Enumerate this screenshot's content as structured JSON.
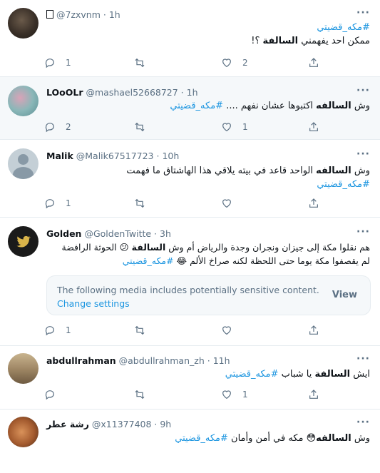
{
  "tweets": [
    {
      "display_name": "",
      "handle": "@7zxvnm",
      "time": "1h",
      "lines": [
        [
          {
            "t": "#مكه_قضيتي",
            "c": "hash"
          }
        ],
        [
          {
            "t": "ممكن احد يفهمني ",
            "c": ""
          },
          {
            "t": "السالفة",
            "c": "b"
          },
          {
            "t": " ؟!",
            "c": ""
          }
        ]
      ],
      "replies": "1",
      "retweets": "",
      "likes": "2"
    },
    {
      "display_name": "LOoOLr",
      "handle": "@mashael52668727",
      "time": "1h",
      "lines": [
        [
          {
            "t": "وش ",
            "c": ""
          },
          {
            "t": "السالفه",
            "c": "b"
          },
          {
            "t": " اكتبوها  عشان نفهم .... ",
            "c": ""
          },
          {
            "t": "#مكه_قضيتي",
            "c": "hash"
          }
        ]
      ],
      "replies": "2",
      "retweets": "",
      "likes": "1"
    },
    {
      "display_name": "Malik",
      "handle": "@Malik67517723",
      "time": "10h",
      "lines": [
        [
          {
            "t": "وش ",
            "c": ""
          },
          {
            "t": "السالفه",
            "c": "b"
          },
          {
            "t": " الواحد قاعد في بيته يلاقي هذا الهاشتاق ما فهمت",
            "c": ""
          }
        ],
        [
          {
            "t": "#مكه_قضيتي",
            "c": "hash"
          }
        ]
      ],
      "replies": "1",
      "retweets": "",
      "likes": ""
    },
    {
      "display_name": "Golden",
      "handle": "@GoldenTwitte",
      "time": "3h",
      "lines": [
        [
          {
            "t": "هم نقلوا مكة إلى جيزان ونجران وجدة والرياض أم وش ",
            "c": ""
          },
          {
            "t": "السالفة",
            "c": "b"
          },
          {
            "t": " 😕 الحوثة الرافضة",
            "c": ""
          }
        ],
        [
          {
            "t": "لم يقصفوا مكة يوما حتى اللحظة لكنه صراخ الألم 😂 ",
            "c": ""
          },
          {
            "t": "#مكه_قضيتي",
            "c": "hash"
          }
        ]
      ],
      "warning": {
        "message": "The following media includes potentially sensitive content.",
        "link": "Change settings",
        "button": "View"
      },
      "replies": "1",
      "retweets": "",
      "likes": ""
    },
    {
      "display_name": "abdullrahman",
      "handle": "@abdullrahman_zh",
      "time": "11h",
      "lines": [
        [
          {
            "t": "ايش ",
            "c": ""
          },
          {
            "t": "السالفة",
            "c": "b"
          },
          {
            "t": " يا شباب  ",
            "c": ""
          },
          {
            "t": "#مكه_قضيتي",
            "c": "hash"
          }
        ]
      ],
      "replies": "",
      "retweets": "",
      "likes": "1"
    },
    {
      "display_name": "رشة عطر",
      "handle": "@x11377408",
      "time": "9h",
      "lines": [
        [
          {
            "t": "وش ",
            "c": ""
          },
          {
            "t": "السالفه",
            "c": "b"
          },
          {
            "t": "😳 مكه في أمن وأمان  ",
            "c": ""
          },
          {
            "t": "#مكه_قضيتي",
            "c": "hash"
          }
        ]
      ],
      "replies": "",
      "retweets": "",
      "likes": ""
    }
  ],
  "colors": {
    "link": "#1b95e0",
    "meta": "#5b7083",
    "highlight_bg": "#f5f8fa"
  },
  "icons": {
    "reply": "reply-icon",
    "retweet": "retweet-icon",
    "like": "heart-icon",
    "share": "share-icon",
    "more": "more-icon"
  }
}
